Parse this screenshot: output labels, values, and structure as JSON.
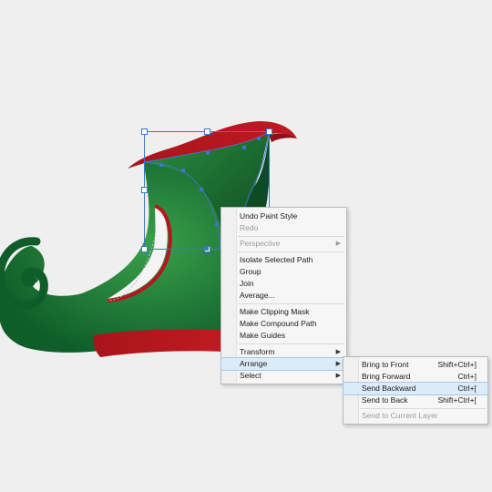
{
  "colors": {
    "canvas": "#efefef",
    "shoe_green_dark": "#0f5e2a",
    "shoe_green_light": "#3aa04a",
    "shoe_inner_dark": "#103f22",
    "shoe_red": "#b5161e",
    "selection_blue": "#3b78c8",
    "menu_bg": "#f6f6f6",
    "menu_highlight": "#dcebf8"
  },
  "context_menu": {
    "items": [
      {
        "label": "Undo Paint Style",
        "disabled": false
      },
      {
        "label": "Redo",
        "disabled": true
      },
      {
        "label": "Perspective",
        "disabled": true,
        "submenu": true
      },
      {
        "label": "Isolate Selected Path",
        "disabled": false
      },
      {
        "label": "Group",
        "disabled": false
      },
      {
        "label": "Join",
        "disabled": false
      },
      {
        "label": "Average...",
        "disabled": false
      },
      {
        "label": "Make Clipping Mask",
        "disabled": false
      },
      {
        "label": "Make Compound Path",
        "disabled": false
      },
      {
        "label": "Make Guides",
        "disabled": false
      },
      {
        "label": "Transform",
        "disabled": false,
        "submenu": true
      },
      {
        "label": "Arrange",
        "disabled": false,
        "submenu": true,
        "active": true
      },
      {
        "label": "Select",
        "disabled": false,
        "submenu": true
      }
    ]
  },
  "arrange_submenu": {
    "items": [
      {
        "label": "Bring to Front",
        "shortcut": "Shift+Ctrl+]",
        "disabled": false
      },
      {
        "label": "Bring Forward",
        "shortcut": "Ctrl+]",
        "disabled": false
      },
      {
        "label": "Send Backward",
        "shortcut": "Ctrl+[",
        "disabled": false,
        "highlighted": true
      },
      {
        "label": "Send to Back",
        "shortcut": "Shift+Ctrl+[",
        "disabled": false
      },
      {
        "label": "Send to Current Layer",
        "shortcut": "",
        "disabled": true
      }
    ]
  },
  "icons": {
    "submenu_arrow": "triangle-right-icon"
  }
}
